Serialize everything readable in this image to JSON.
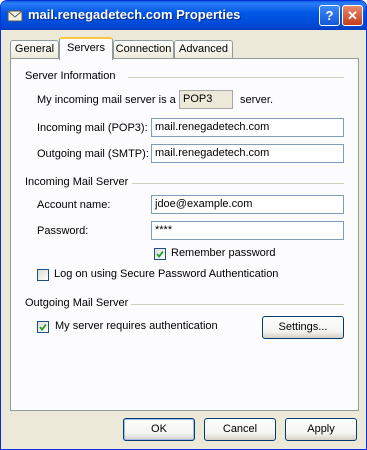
{
  "window": {
    "title": "mail.renegadetech.com Properties"
  },
  "titlebar_buttons": {
    "help": "?",
    "close": "✕"
  },
  "tabs": [
    {
      "label": "General",
      "active": false
    },
    {
      "label": "Servers",
      "active": true
    },
    {
      "label": "Connection",
      "active": false
    },
    {
      "label": "Advanced",
      "active": false
    }
  ],
  "server_info": {
    "group_label": "Server Information",
    "incoming_type_prefix": "My incoming mail server is a",
    "incoming_type_value": "POP3",
    "incoming_type_suffix": "server.",
    "incoming_label": "Incoming mail (POP3):",
    "incoming_value": "mail.renegadetech.com",
    "outgoing_label": "Outgoing mail (SMTP):",
    "outgoing_value": "mail.renegadetech.com"
  },
  "incoming_server": {
    "group_label": "Incoming Mail Server",
    "account_label": "Account name:",
    "account_value": "jdoe@example.com",
    "password_label": "Password:",
    "password_value": "****",
    "remember_label": "Remember password",
    "remember_checked": true,
    "spa_label": "Log on using Secure Password Authentication",
    "spa_checked": false
  },
  "outgoing_server": {
    "group_label": "Outgoing Mail Server",
    "auth_label": "My server requires authentication",
    "auth_checked": true,
    "settings_button": "Settings..."
  },
  "footer": {
    "ok": "OK",
    "cancel": "Cancel",
    "apply": "Apply"
  }
}
